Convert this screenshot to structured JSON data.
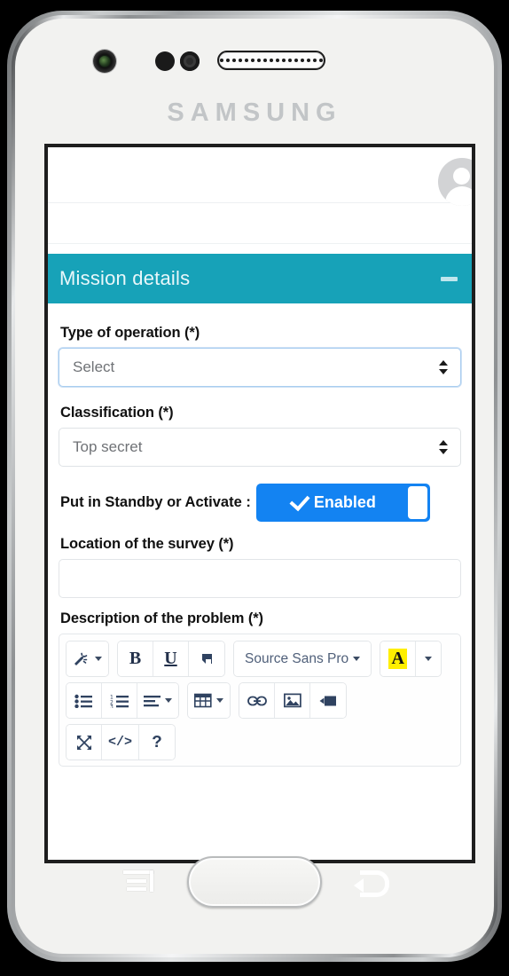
{
  "device": {
    "brand": "SAMSUNG",
    "hardware": {
      "camera": "camera-lens",
      "sensor_a": "proximity-sensor",
      "sensor_b": "light-sensor",
      "speaker": "earpiece-speaker",
      "home_button": "home-button",
      "menu_key": "menu-key",
      "back_key": "back-key"
    }
  },
  "colors": {
    "panel_header": "#17a2b8",
    "toggle_on": "#1383f2",
    "highlight": "#ffef00",
    "label_text": "#111111",
    "placeholder_text": "#6f7276"
  },
  "app": {
    "avatar": "user-avatar"
  },
  "panel": {
    "title": "Mission details",
    "collapse_icon": "minus-icon"
  },
  "form": {
    "fields": [
      {
        "label": "Type of operation (*)",
        "type": "select",
        "value": "Select",
        "focused": true
      },
      {
        "label": "Classification (*)",
        "type": "select",
        "value": "Top secret",
        "focused": false
      },
      {
        "label": "Put in Standby or Activate :",
        "type": "toggle",
        "value": "Enabled",
        "state": "on"
      },
      {
        "label": "Location of the survey (*)",
        "type": "text",
        "value": "",
        "placeholder": ""
      },
      {
        "label": "Description of the problem (*)",
        "type": "richtext",
        "value": ""
      }
    ]
  },
  "editor": {
    "toolbar": [
      {
        "groups": [
          {
            "buttons": [
              {
                "name": "magic-wand-icon",
                "label": "",
                "has_caret": true
              }
            ]
          },
          {
            "buttons": [
              {
                "name": "bold-icon",
                "label": "B",
                "has_caret": false
              },
              {
                "name": "underline-icon",
                "label": "U",
                "has_caret": false
              },
              {
                "name": "remove-format-icon",
                "label": "",
                "has_caret": false
              }
            ]
          },
          {
            "buttons": [
              {
                "name": "font-family-dropdown",
                "label": "Source Sans Pro",
                "has_caret": true
              }
            ]
          },
          {
            "buttons": [
              {
                "name": "text-highlight-icon",
                "label": "A",
                "has_caret": false
              },
              {
                "name": "highlight-color-caret",
                "label": "",
                "has_caret": true
              }
            ]
          }
        ]
      },
      {
        "groups": [
          {
            "buttons": [
              {
                "name": "unordered-list-icon",
                "label": "",
                "has_caret": false
              },
              {
                "name": "ordered-list-icon",
                "label": "",
                "has_caret": false
              },
              {
                "name": "paragraph-align-icon",
                "label": "",
                "has_caret": true
              }
            ]
          },
          {
            "buttons": [
              {
                "name": "table-icon",
                "label": "",
                "has_caret": true
              }
            ]
          },
          {
            "buttons": [
              {
                "name": "link-icon",
                "label": "",
                "has_caret": false
              },
              {
                "name": "image-icon",
                "label": "",
                "has_caret": false
              },
              {
                "name": "video-icon",
                "label": "",
                "has_caret": false
              }
            ]
          }
        ]
      },
      {
        "groups": [
          {
            "buttons": [
              {
                "name": "fullscreen-icon",
                "label": "",
                "has_caret": false
              },
              {
                "name": "code-view-icon",
                "label": "</>",
                "has_caret": false
              },
              {
                "name": "help-icon",
                "label": "?",
                "has_caret": false
              }
            ]
          }
        ]
      }
    ]
  }
}
